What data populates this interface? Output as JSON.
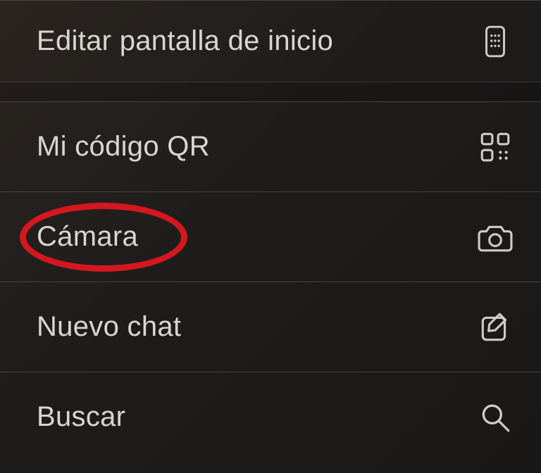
{
  "menu": {
    "items": [
      {
        "label": "Editar pantalla de inicio",
        "icon": "phone-grid-icon",
        "highlighted": false
      },
      {
        "label": "Mi código QR",
        "icon": "qr-icon",
        "highlighted": false
      },
      {
        "label": "Cámara",
        "icon": "camera-icon",
        "highlighted": true
      },
      {
        "label": "Nuevo chat",
        "icon": "compose-icon",
        "highlighted": false
      },
      {
        "label": "Buscar",
        "icon": "search-icon",
        "highlighted": false
      }
    ]
  },
  "annotation": {
    "type": "ellipse",
    "color": "#d4181f",
    "targetIndex": 2
  }
}
